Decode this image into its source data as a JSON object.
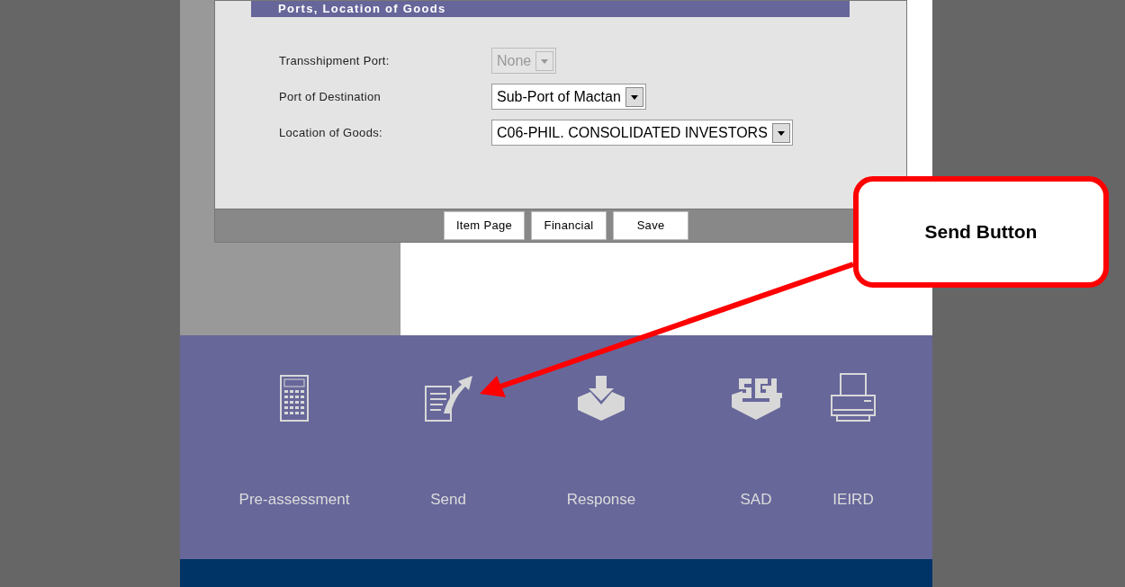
{
  "section": {
    "title": "Ports, Location of Goods"
  },
  "fields": [
    {
      "label": "Transshipment Port:",
      "value": "None",
      "disabled": true
    },
    {
      "label": "Port of Destination",
      "value": "Sub-Port of Mactan",
      "disabled": false
    },
    {
      "label": "Location of Goods:",
      "value": "C06-PHIL. CONSOLIDATED INVESTORS",
      "disabled": false
    }
  ],
  "buttons": [
    "Item Page",
    "Financial",
    "Save"
  ],
  "nav": [
    {
      "kind": "calculator",
      "label": "Pre-assessment"
    },
    {
      "kind": "send",
      "label": "Send"
    },
    {
      "kind": "response",
      "label": "Response"
    },
    {
      "kind": "sgl",
      "label": "SAD"
    },
    {
      "kind": "printer",
      "label": "IEIRD"
    }
  ],
  "callout": {
    "text": "Send Button"
  }
}
